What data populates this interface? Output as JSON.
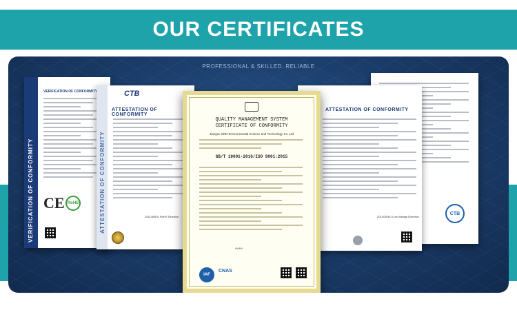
{
  "banner": {
    "title": "OUR CERTIFICATES"
  },
  "stage": {
    "tagline": "PROFESSIONAL & SKILLED, RELIABLE"
  },
  "certificates": {
    "voc": {
      "side_text": "VERIFICATION OF CONFORMITY",
      "heading": "VERIFICATION OF CONFORMITY",
      "mark_ce": "CE",
      "mark_rohs": "RoHS"
    },
    "attestation_left": {
      "logo": "CTB",
      "side_text": "ATTESTATION OF CONFORMITY",
      "title": "ATTESTATION OF CONFORMITY",
      "directive": "2011/65/EU RoHS Directive"
    },
    "qms": {
      "title_line1": "QUALITY MANAGEMENT SYSTEM",
      "title_line2": "CERTIFICATE OF CONFORMITY",
      "company": "Jiangsu SRD Environmental Science and Technology Co.,Ltd",
      "standard": "GB/T 19001-2016/ISO 9001:2015",
      "mark_iaf": "IAF",
      "mark_cnas": "CNAS"
    },
    "attestation_right": {
      "title": "ATTESTATION OF CONFORMITY",
      "directive": "2014/35/EU Low Voltage Directive"
    },
    "far_right": {
      "badge": "CTB"
    }
  },
  "colors": {
    "teal": "#1fa3aa",
    "navy": "#1b3a78",
    "stage": "#1c3f6e"
  }
}
